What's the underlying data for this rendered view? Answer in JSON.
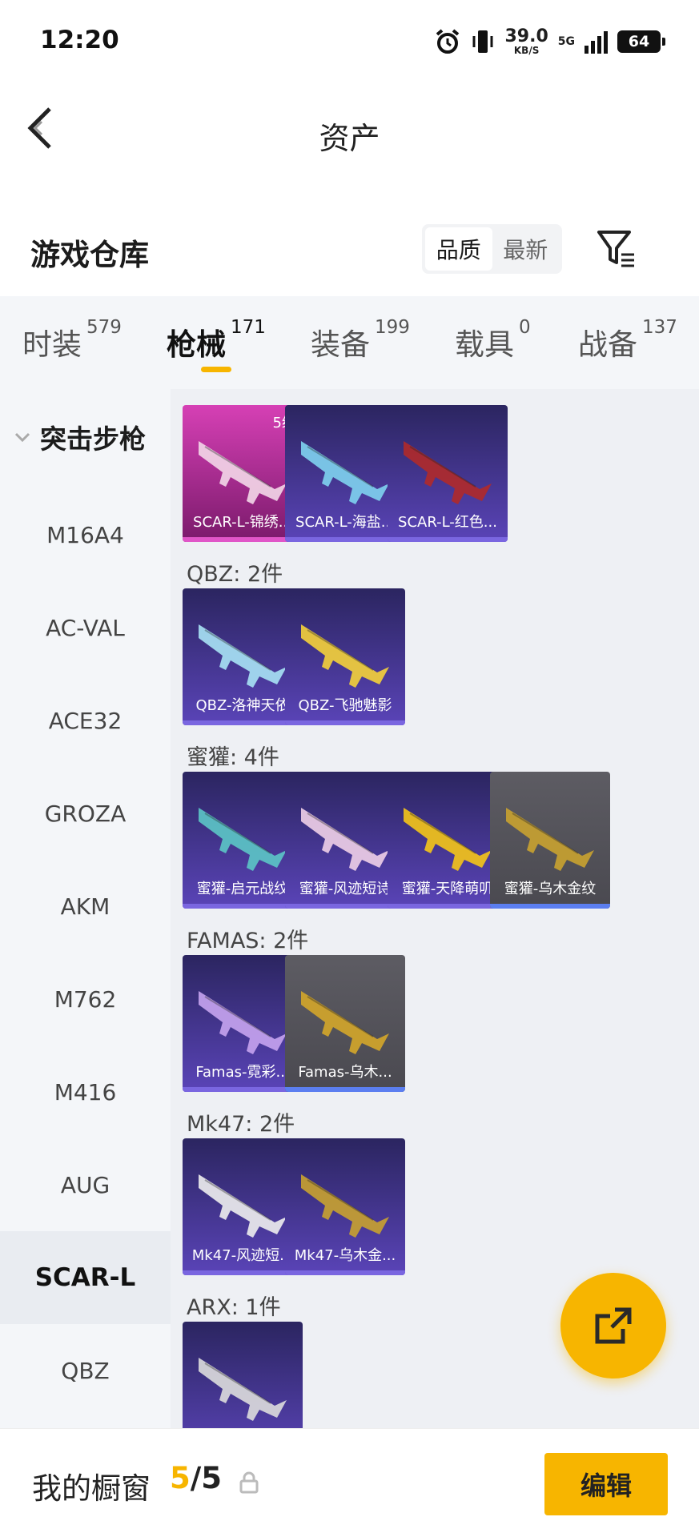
{
  "status_bar": {
    "time": "12:20",
    "net_speed": "39.0",
    "net_speed_unit": "KB/S",
    "network": "5G",
    "battery": "64"
  },
  "header": {
    "title": "资产"
  },
  "warehouse": {
    "title": "游戏仓库",
    "sort_options": [
      "品质",
      "最新"
    ],
    "sort_selected": "品质"
  },
  "category_tabs": [
    {
      "label": "时装",
      "count": "579"
    },
    {
      "label": "枪械",
      "count": "171",
      "active": true
    },
    {
      "label": "装备",
      "count": "199"
    },
    {
      "label": "载具",
      "count": "0"
    },
    {
      "label": "战备",
      "count": "137"
    }
  ],
  "sidebar": {
    "group": "突击步枪",
    "items": [
      "M16A4",
      "AC-VAL",
      "ACE32",
      "GROZA",
      "AKM",
      "M762",
      "M416",
      "AUG",
      "SCAR-L",
      "QBZ"
    ],
    "active": "SCAR-L"
  },
  "groups": [
    {
      "label": "",
      "items": [
        {
          "name": "SCAR-L-锦绣...",
          "rarity": "pink",
          "level": "5级"
        },
        {
          "name": "SCAR-L-海盐...",
          "rarity": "purple"
        },
        {
          "name": "SCAR-L-红色...",
          "rarity": "purple"
        }
      ]
    },
    {
      "label": "QBZ: 2件",
      "items": [
        {
          "name": "QBZ-洛神天依",
          "rarity": "purple"
        },
        {
          "name": "QBZ-飞驰魅影",
          "rarity": "purple"
        }
      ]
    },
    {
      "label": "蜜獾: 4件",
      "items": [
        {
          "name": "蜜獾-启元战纹",
          "rarity": "purple"
        },
        {
          "name": "蜜獾-风迹短诗",
          "rarity": "purple"
        },
        {
          "name": "蜜獾-天降萌叽",
          "rarity": "purple"
        },
        {
          "name": "蜜獾-乌木金纹",
          "rarity": "grey"
        }
      ]
    },
    {
      "label": "FAMAS: 2件",
      "items": [
        {
          "name": "Famas-霓彩...",
          "rarity": "purple"
        },
        {
          "name": "Famas-乌木...",
          "rarity": "grey"
        }
      ]
    },
    {
      "label": "Mk47: 2件",
      "items": [
        {
          "name": "Mk47-风迹短...",
          "rarity": "purple"
        },
        {
          "name": "Mk47-乌木金...",
          "rarity": "purple"
        }
      ]
    },
    {
      "label": "ARX: 1件",
      "items": [
        {
          "name": "",
          "rarity": "purple"
        }
      ]
    }
  ],
  "showcase": {
    "label": "我的橱窗",
    "current": "5",
    "separator": "/",
    "total": "5",
    "edit_label": "编辑"
  },
  "colors": {
    "accent": "#f7b500",
    "purple_card": "#3b2f7a",
    "pink_card": "#b0268f",
    "grey_card": "#55545c"
  }
}
